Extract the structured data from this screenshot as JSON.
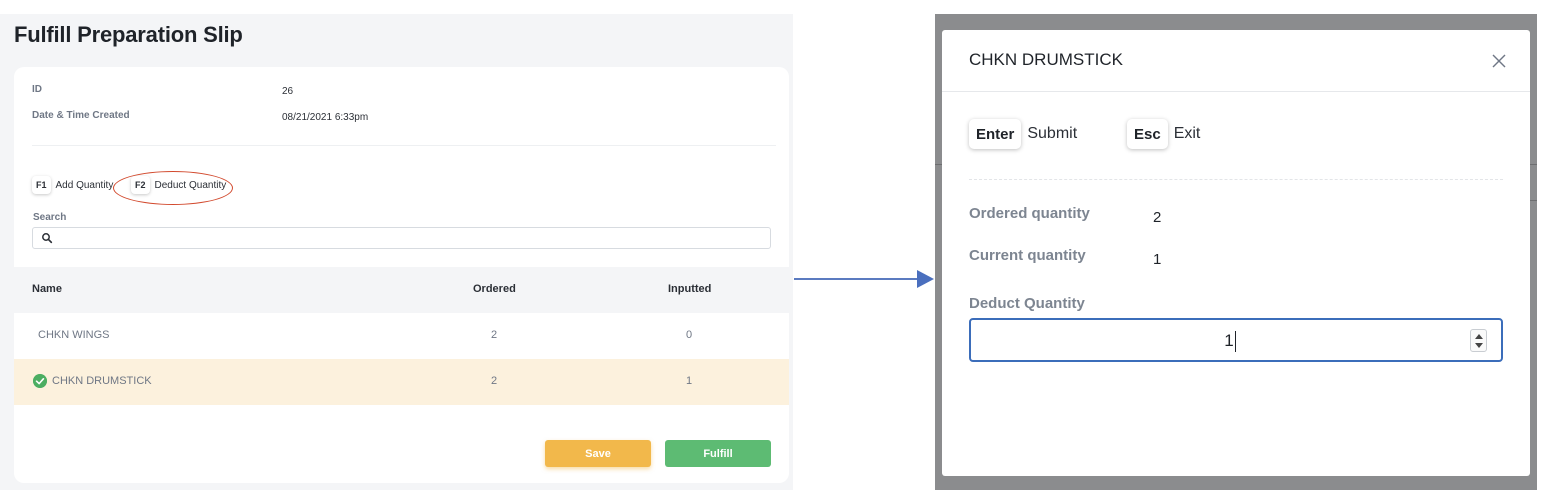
{
  "left": {
    "title": "Fulfill Preparation Slip",
    "id_label": "ID",
    "id_value": "26",
    "date_label": "Date & Time Created",
    "date_value": "08/21/2021 6:33pm",
    "shortcuts": [
      {
        "key": "F1",
        "label": "Add Quantity"
      },
      {
        "key": "F2",
        "label": "Deduct Quantity"
      }
    ],
    "search": {
      "label": "Search",
      "placeholder": "",
      "value": ""
    },
    "table": {
      "headers": [
        "Name",
        "Ordered",
        "Inputted"
      ],
      "rows": [
        {
          "name": "CHKN WINGS",
          "ordered": "2",
          "inputted": "0",
          "checked": false
        },
        {
          "name": "CHKN DRUMSTICK",
          "ordered": "2",
          "inputted": "1",
          "checked": true
        }
      ]
    },
    "buttons": {
      "save": "Save",
      "fulfill": "Fulfill"
    },
    "colors": {
      "save": "#f2b84b",
      "fulfill": "#5dbb73",
      "highlight_row": "#fcf1dd",
      "annotation": "#d24a2e"
    }
  },
  "modal": {
    "title": "CHKN DRUMSTICK",
    "shortcuts": [
      {
        "key": "Enter",
        "label": "Submit"
      },
      {
        "key": "Esc",
        "label": "Exit"
      }
    ],
    "ordered_label": "Ordered quantity",
    "ordered_value": "2",
    "current_label": "Current quantity",
    "current_value": "1",
    "deduct_label": "Deduct Quantity",
    "deduct_value": "1",
    "colors": {
      "input_border": "#3b6dba",
      "arrow": "#4a6fbe"
    }
  }
}
